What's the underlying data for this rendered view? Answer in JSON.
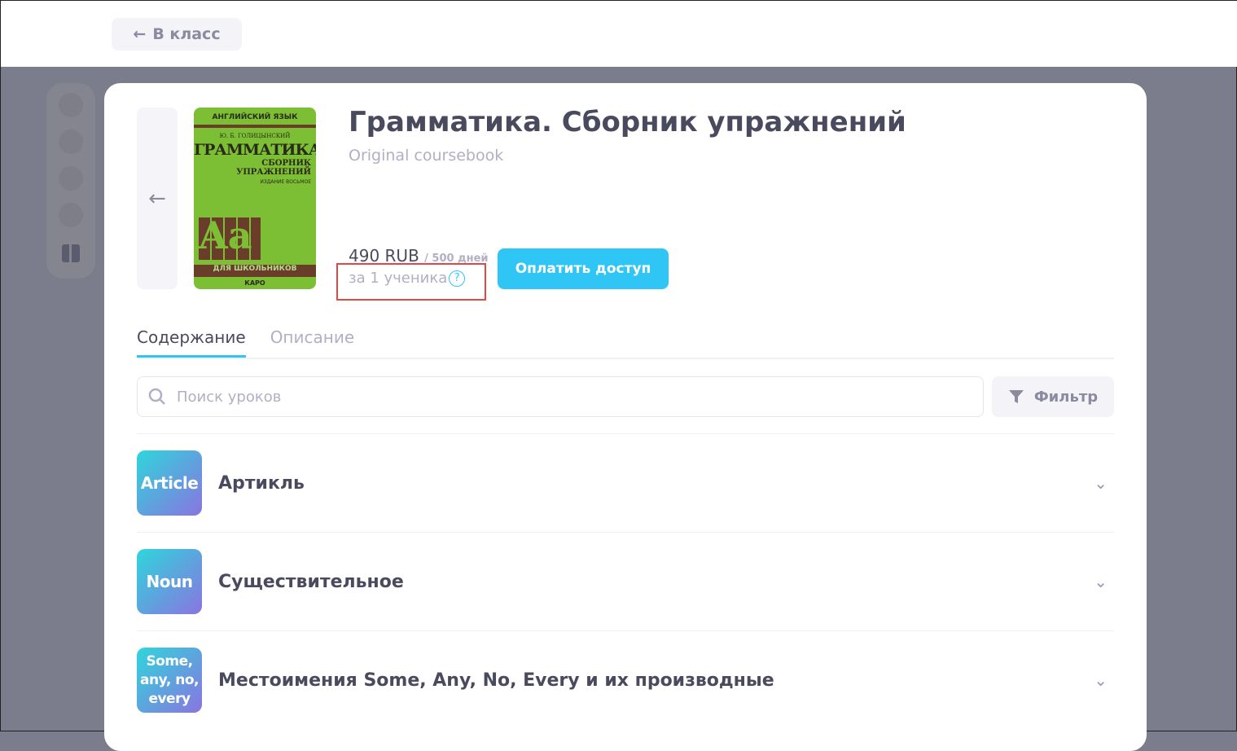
{
  "header": {
    "back_label": "В класс"
  },
  "course": {
    "title": "Грамматика. Сборник упражнений",
    "subtitle": "Original coursebook",
    "price": "490 RUB",
    "period": "/ 500 дней",
    "per_student": "за 1 ученика",
    "help": "?",
    "pay_label": "Оплатить доступ",
    "cover": {
      "lang": "АНГЛИЙСКИЙ ЯЗЫК",
      "author": "Ю. Б. ГОЛИЦЫНСКИЙ",
      "title": "ГРАММАТИКА",
      "sub1": "СБОРНИК",
      "sub2": "УПРАЖНЕНИЙ",
      "edition": "ИЗДАНИЕ ВОСЬМОЕ",
      "letters": "Aa",
      "audience": "ДЛЯ ШКОЛЬНИКОВ",
      "publisher": "КАРО"
    }
  },
  "tabs": [
    {
      "label": "Содержание"
    },
    {
      "label": "Описание"
    }
  ],
  "search": {
    "placeholder": "Поиск уроков"
  },
  "filter_label": "Фильтр",
  "lessons": [
    {
      "badge": "Article",
      "title": "Артикль"
    },
    {
      "badge": "Noun",
      "title": "Существительное"
    },
    {
      "badge": "Some, any, no, every",
      "title": "Местоимения Some, Any, No, Every и их производные"
    }
  ]
}
